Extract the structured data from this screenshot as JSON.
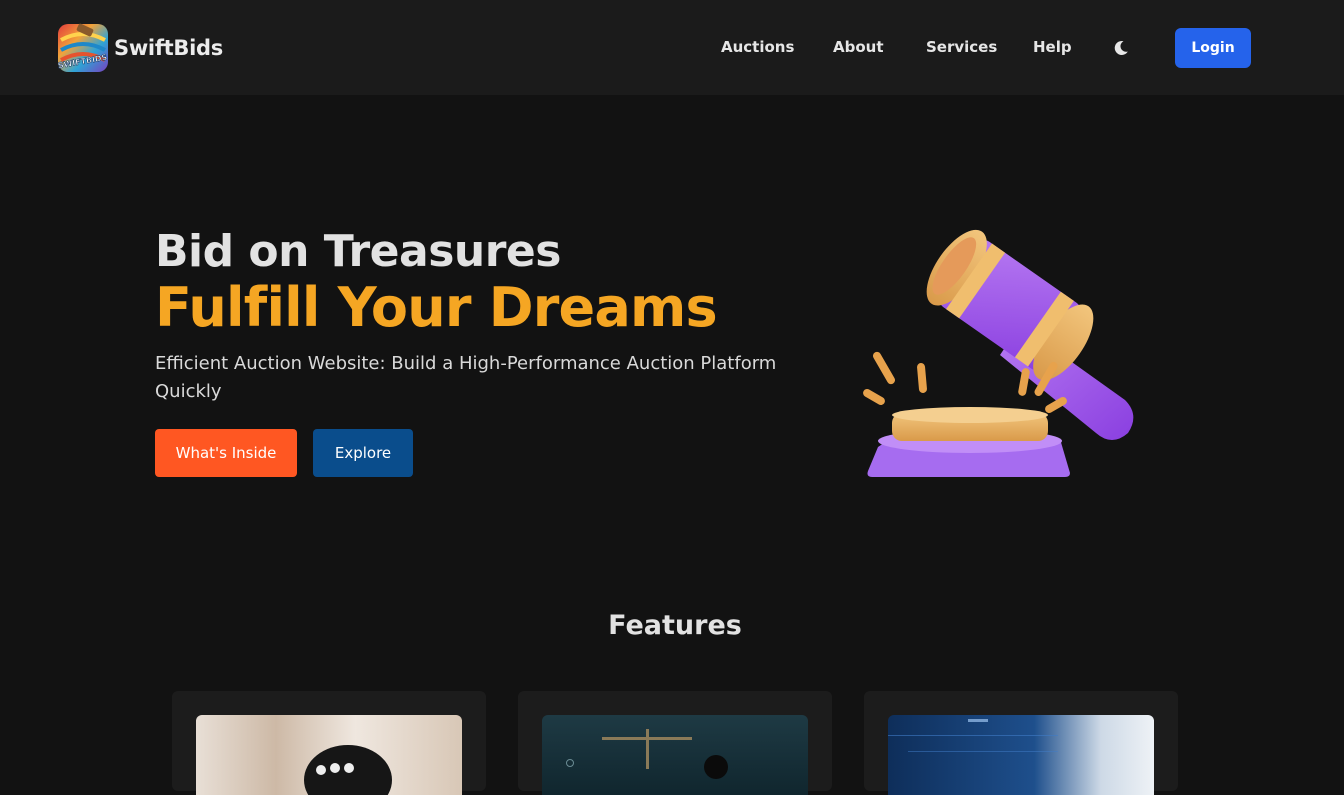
{
  "navbar": {
    "brand": "SwiftBids",
    "logo_text": "SWIFTBIDS",
    "links": [
      "Auctions",
      "About",
      "Services",
      "Help"
    ],
    "theme_toggle_icon": "moon-icon",
    "login_label": "Login"
  },
  "hero": {
    "title_line1": "Bid on Treasures",
    "title_line2": "Fulfill Your Dreams",
    "subtitle": "Efficient Auction Website: Build a High-Performance Auction Platform Quickly",
    "primary_button": "What's Inside",
    "secondary_button": "Explore",
    "illustration": "gavel-illustration"
  },
  "features": {
    "title": "Features",
    "cards": [
      {
        "image": "auction-crowd-image"
      },
      {
        "image": "justice-scales-image"
      },
      {
        "image": "digital-hand-image"
      }
    ]
  },
  "colors": {
    "background": "#121212",
    "navbar": "#1b1b1b",
    "accent_orange": "#f5a623",
    "button_orange": "#ff5722",
    "button_blue": "#0a4d8c",
    "login_blue": "#2563eb"
  }
}
